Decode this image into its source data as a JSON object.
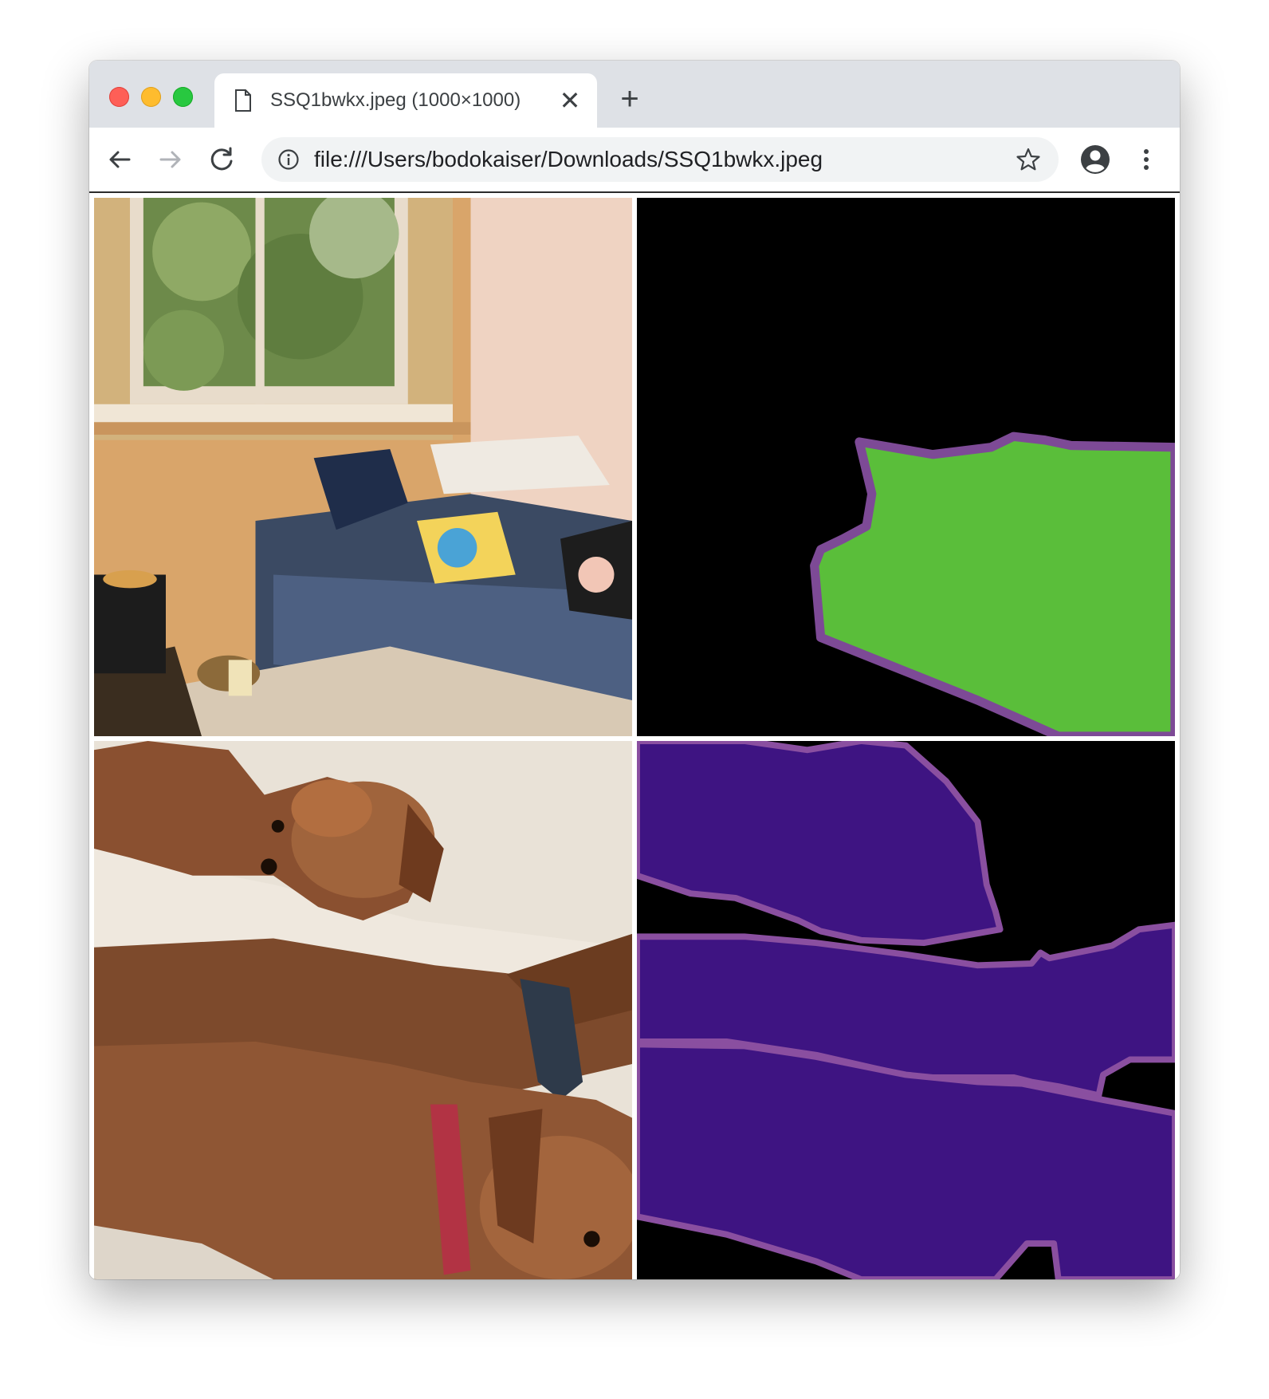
{
  "browser": {
    "tab": {
      "title": "SSQ1bwkx.jpeg (1000×1000)",
      "close_glyph": "✕",
      "icon": "document-icon"
    },
    "new_tab_glyph": "+",
    "address_bar": {
      "url": "file:///Users/bodokaiser/Downloads/SSQ1bwkx.jpeg",
      "info_icon": "info-icon"
    },
    "toolbar_icons": [
      "back-arrow-icon",
      "forward-arrow-icon",
      "reload-icon",
      "star-icon",
      "profile-icon",
      "menu-icon"
    ]
  },
  "image": {
    "panels": [
      {
        "name": "living-room-photo",
        "content": "photo"
      },
      {
        "name": "sofa-segmentation-mask",
        "content": "mask",
        "fill_color": "#5abe3a",
        "outline_color": "#7d4a96"
      },
      {
        "name": "dachshunds-photo",
        "content": "photo"
      },
      {
        "name": "dogs-segmentation-mask",
        "content": "mask",
        "fill_color": "#3e1482",
        "outline_color": "#8a4fa0"
      }
    ],
    "background_color": "#000000"
  }
}
